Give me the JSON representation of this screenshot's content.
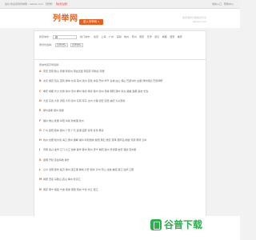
{
  "topbar": {
    "left_text": "您好,欢迎来到列举网 - liebiao.com",
    "left_link": "【登录】",
    "left_hot": "【免费注册】",
    "right_text": "我的入口 · 帮助中心"
  },
  "header": {
    "logo": "列举网",
    "slogan": "进入列举网 »",
    "right_line1": "免费发布分类信息平台",
    "right_line2": "liebiao.com"
  },
  "search": {
    "label": "搜索城市:",
    "hot_label": "热门城市:",
    "hot_cities": [
      "北京",
      "上海",
      "广州",
      "深圳",
      "杭州",
      "苏州",
      "南京",
      "天津",
      "武汉",
      "成都",
      "西安",
      "重庆"
    ],
    "select_label": "按省份选择:",
    "province_placeholder": "选择省份",
    "city_placeholder": "选择城市"
  },
  "list": {
    "title": "按城市首字母选择:",
    "rows": [
      {
        "letter": "A",
        "cities": "安庆 安阳 鞍山 安顺 阿坝州 阿拉善盟 阿克苏 阿勒泰 阿里"
      },
      {
        "letter": "B",
        "cities": "北京 保定 包头 宝鸡 蚌埠 北海 亳州 滨州 百色 本溪 巴中 毕节 白城 白山 保山 巴彦淖尔 白银 博尔塔拉 巴音郭楞"
      },
      {
        "letter": "C",
        "cities": "重庆 成都 长沙 长春 常州 沧州 郴州 常德 承德 滁州 池州 赤峰 朝阳 潮州 崇左 楚雄 昌都 昌吉 长治"
      },
      {
        "letter": "D",
        "cities": "大连 东莞 大庆 德阳 大同 德州 东营 丹东 达州 大理 德宏 定西 迪庆 大兴安岭"
      },
      {
        "letter": "E",
        "cities": "鄂尔多斯 鄂州 恩施"
      },
      {
        "letter": "F",
        "cities": "福州 佛山 抚顺 阜阳 阜新 防城港 抚州"
      },
      {
        "letter": "G",
        "cities": "广州 贵阳 桂林 赣州 广安 广元 贵港 固原 甘南 甘孜 果洛"
      },
      {
        "letter": "H",
        "cities": "杭州 合肥 哈尔滨 海口 惠州 邯郸 湖州 呼和浩特 衡阳 黄石 淮安 菏泽 葫芦岛 鹤壁 河源 黄冈 汉中"
      },
      {
        "letter": "J",
        "cities": "济南 嘉兴 金华 江门 九江 吉林 焦作 晋中 荆州 济宁 揭阳 锦州 景德镇 吉安 酒泉 佳木斯"
      },
      {
        "letter": "K",
        "cities": "昆明 开封 克拉玛依 喀什"
      },
      {
        "letter": "L",
        "cities": "兰州 洛阳 廊坊 临沂 柳州 连云港 聊城 六安 丽水 泸州 乐山 龙岩 娄底 丽江 拉萨 辽阳"
      },
      {
        "letter": "M",
        "cities": "绵阳 茂名 马鞍山 眉山 梅州 牡丹江"
      },
      {
        "letter": "N",
        "cities": "南京 南宁 南昌 宁波 南通 南阳 南充 宁德 内江 怒江"
      }
    ]
  },
  "watermark": {
    "text": "谷普下载"
  }
}
